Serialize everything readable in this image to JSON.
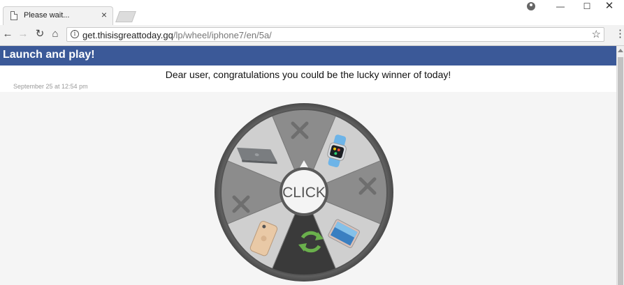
{
  "browser": {
    "tab_title": "Please wait...",
    "tab_close": "×",
    "url_domain": "get.thisisgreattoday.gq",
    "url_path": "/lp/wheel/iphone7/en/5a/",
    "win_min": "—",
    "win_max": "☐",
    "win_close": "✕"
  },
  "page": {
    "header_title": "Launch and play!",
    "message": "Dear user, congratulations you could be the lucky winner of today!",
    "date": "September 25 at 12:54 pm"
  },
  "wheel": {
    "center_label": "CLICK",
    "segments": [
      {
        "icon": "x-icon",
        "color": "#8c8c8c"
      },
      {
        "icon": "apple-watch-icon",
        "color": "#cfcfcf"
      },
      {
        "icon": "x-icon",
        "color": "#8c8c8c"
      },
      {
        "icon": "ipad-icon",
        "color": "#cfcfcf"
      },
      {
        "icon": "refresh-icon",
        "color": "#3a3a3a"
      },
      {
        "icon": "iphone-icon",
        "color": "#cfcfcf"
      },
      {
        "icon": "x-icon",
        "color": "#8c8c8c"
      },
      {
        "icon": "macbook-icon",
        "color": "#cfcfcf"
      }
    ]
  },
  "colors": {
    "header": "#3b5998",
    "refresh_green": "#6ab04c"
  }
}
